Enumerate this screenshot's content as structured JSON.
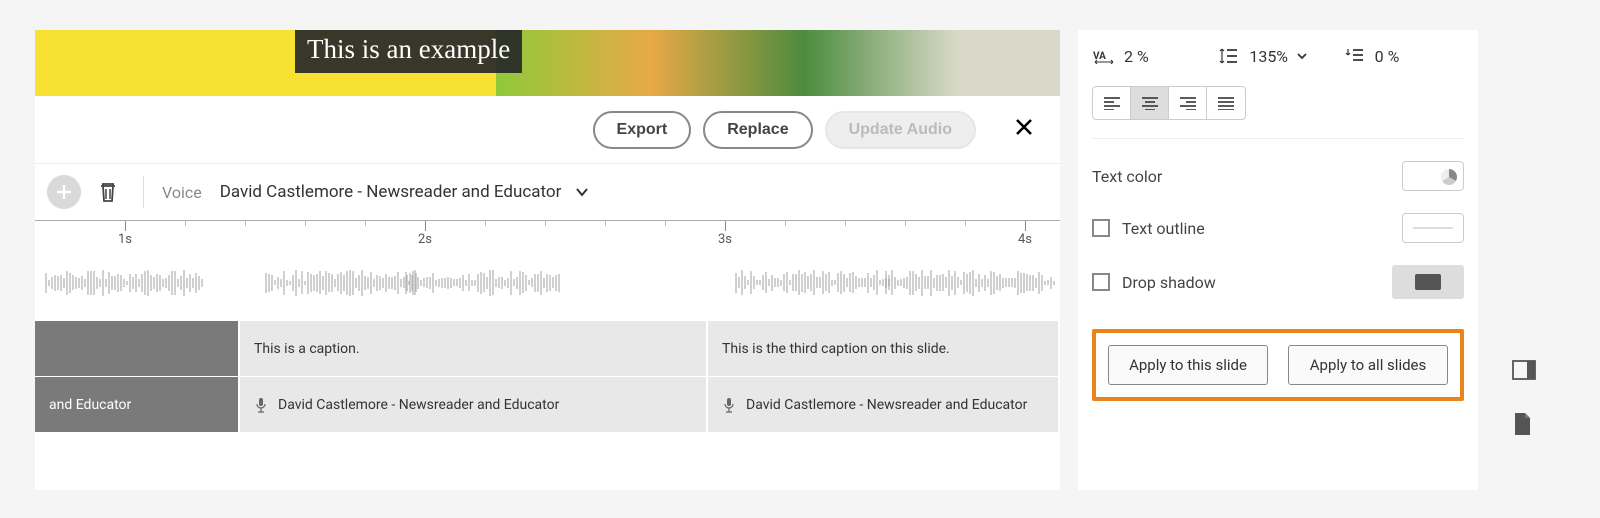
{
  "preview": {
    "caption_text": "This is an example"
  },
  "actions": {
    "export_label": "Export",
    "replace_label": "Replace",
    "update_audio_label": "Update Audio"
  },
  "voice": {
    "label": "Voice",
    "selected": "David Castlemore - Newsreader and Educator"
  },
  "timeline": {
    "ticks": [
      "1s",
      "2s",
      "3s",
      "4s"
    ]
  },
  "captions": {
    "a": "",
    "b": "This is a caption.",
    "c": "This is the third caption on this slide."
  },
  "speakers": {
    "a": "and Educator",
    "b": "David Castlemore - Newsreader and Educator",
    "c": "David Castlemore - Newsreader and Educator"
  },
  "props": {
    "tracking_value": "2 %",
    "line_height_value": "135%",
    "leading_value": "0 %",
    "text_color_label": "Text color",
    "text_outline_label": "Text outline",
    "drop_shadow_label": "Drop shadow",
    "apply_this": "Apply to this slide",
    "apply_all": "Apply to all slides"
  }
}
